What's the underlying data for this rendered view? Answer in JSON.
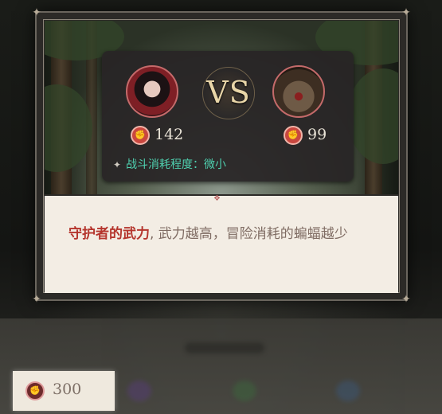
{
  "battle": {
    "vs_label": "VS",
    "player_power": "142",
    "enemy_power": "99",
    "consumption_text": "战斗消耗程度：微小"
  },
  "description": {
    "highlight": "守护者的武力",
    "body": ", 武力越高，冒险消耗的蝙蝠越少"
  },
  "currency": {
    "value": "300",
    "icon": "fist-icon"
  },
  "colors": {
    "accent_red": "#c9473f",
    "consume_green": "#4fd1b0",
    "vs_gold": "#e9d6a8"
  }
}
